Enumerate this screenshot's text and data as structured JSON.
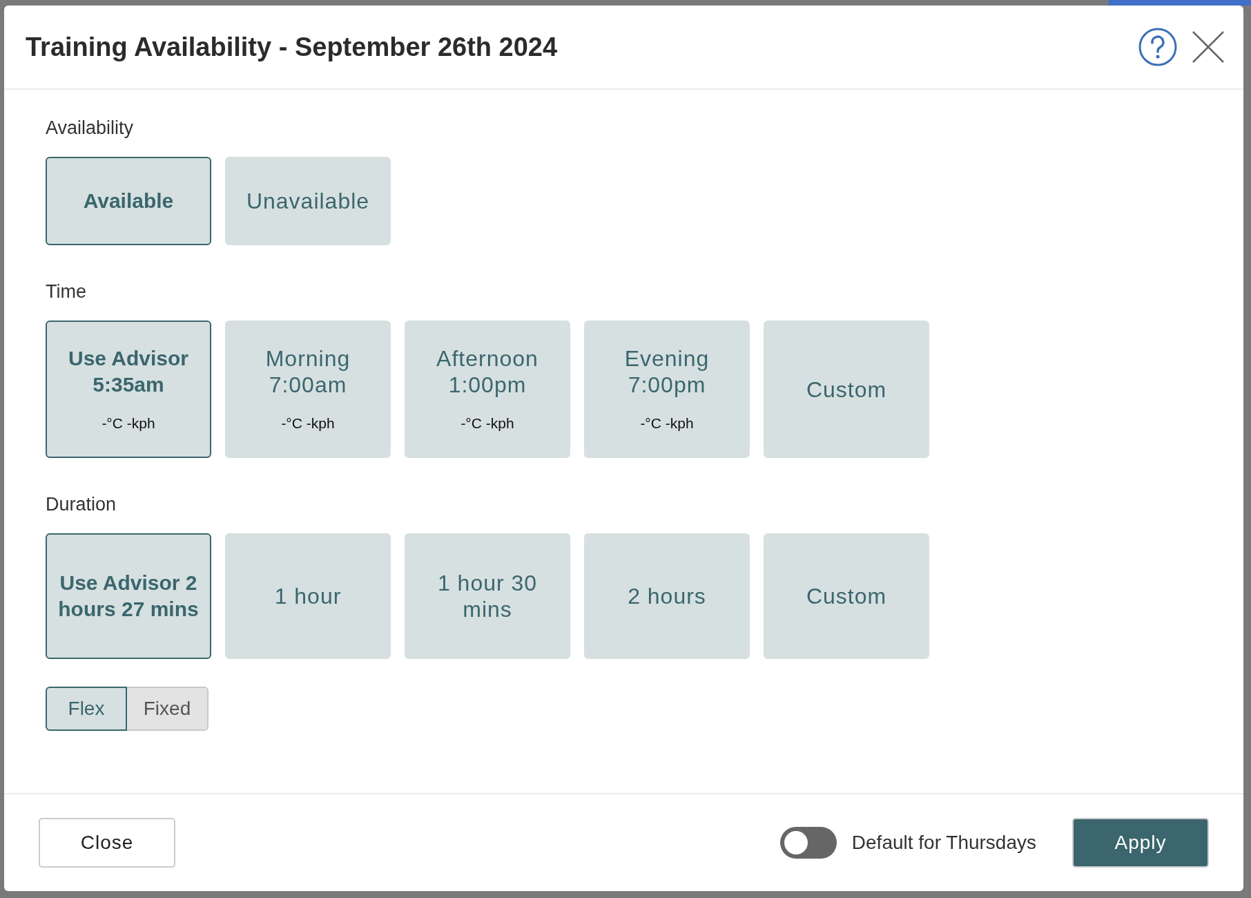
{
  "dialog": {
    "title": "Training Availability - September 26th 2024"
  },
  "sections": [
    {
      "label": "Availability",
      "kind": "short",
      "options": [
        {
          "label": "Available",
          "selected": true
        },
        {
          "label": "Unavailable",
          "selected": false
        }
      ]
    },
    {
      "label": "Time",
      "kind": "tall",
      "options": [
        {
          "label": "Use Advisor",
          "time": "5:35am",
          "weather": "-°C  -kph",
          "selected": true
        },
        {
          "label": "Morning",
          "time": "7:00am",
          "weather": "-°C  -kph",
          "selected": false
        },
        {
          "label": "Afternoon",
          "time": "1:00pm",
          "weather": "-°C  -kph",
          "selected": false
        },
        {
          "label": "Evening",
          "time": "7:00pm",
          "weather": "-°C  -kph",
          "selected": false
        },
        {
          "label": "Custom",
          "selected": false
        }
      ]
    },
    {
      "label": "Duration",
      "kind": "medium",
      "options": [
        {
          "label": "Use Advisor 2 hours 27 mins",
          "selected": true
        },
        {
          "label": "1 hour",
          "selected": false
        },
        {
          "label": "1 hour 30 mins",
          "selected": false
        },
        {
          "label": "2 hours",
          "selected": false
        },
        {
          "label": "Custom",
          "selected": false
        }
      ]
    }
  ],
  "mode": [
    {
      "label": "Flex",
      "selected": true
    },
    {
      "label": "Fixed",
      "selected": false
    }
  ],
  "footer": {
    "close": "Close",
    "default_toggle": {
      "label": "Default for Thursdays",
      "on": false
    },
    "apply": "Apply"
  }
}
